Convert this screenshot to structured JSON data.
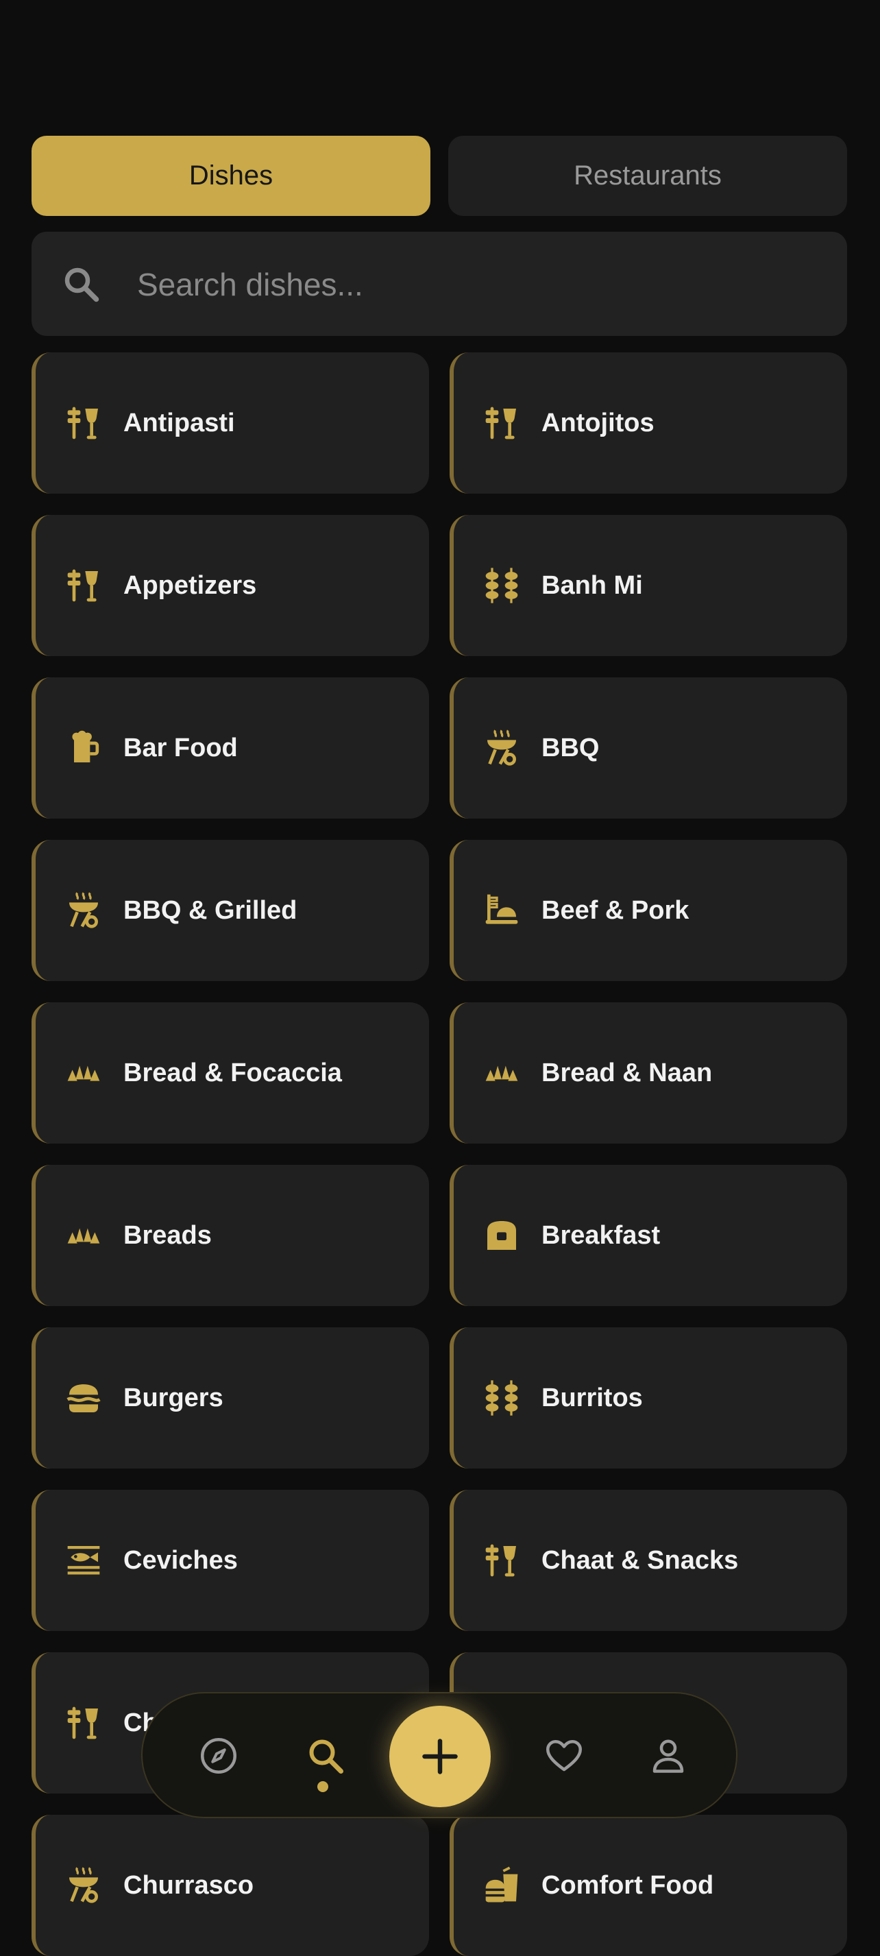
{
  "tabs": {
    "dishes": "Dishes",
    "restaurants": "Restaurants"
  },
  "search": {
    "placeholder": "Search dishes..."
  },
  "categories": [
    {
      "label": "Antipasti",
      "icon": "drinks-icon"
    },
    {
      "label": "Antojitos",
      "icon": "drinks-icon"
    },
    {
      "label": "Appetizers",
      "icon": "drinks-icon"
    },
    {
      "label": "Banh Mi",
      "icon": "kebab-icon"
    },
    {
      "label": "Bar Food",
      "icon": "beer-mug-icon"
    },
    {
      "label": "BBQ",
      "icon": "grill-icon"
    },
    {
      "label": "BBQ & Grilled",
      "icon": "grill-icon"
    },
    {
      "label": "Beef & Pork",
      "icon": "meat-platter-icon"
    },
    {
      "label": "Bread & Focaccia",
      "icon": "croissant-icon"
    },
    {
      "label": "Bread & Naan",
      "icon": "croissant-icon"
    },
    {
      "label": "Breads",
      "icon": "croissant-icon"
    },
    {
      "label": "Breakfast",
      "icon": "toast-icon"
    },
    {
      "label": "Burgers",
      "icon": "burger-icon"
    },
    {
      "label": "Burritos",
      "icon": "kebab-icon"
    },
    {
      "label": "Ceviches",
      "icon": "fish-icon"
    },
    {
      "label": "Chaat & Snacks",
      "icon": "drinks-icon"
    },
    {
      "label": "Ch",
      "icon": "drinks-icon"
    },
    {
      "label": "",
      "icon": ""
    },
    {
      "label": "Churrasco",
      "icon": "grill-icon"
    },
    {
      "label": "Comfort Food",
      "icon": "burger-drink-icon"
    }
  ],
  "nav": {
    "items": [
      {
        "icon": "compass-icon",
        "name": "nav-explore"
      },
      {
        "icon": "search-icon",
        "name": "nav-search",
        "active": true
      },
      {
        "icon": "plus-icon",
        "name": "nav-add"
      },
      {
        "icon": "heart-icon",
        "name": "nav-favorites"
      },
      {
        "icon": "user-icon",
        "name": "nav-profile"
      }
    ]
  },
  "colors": {
    "accent": "#c9a94a",
    "card": "#202020",
    "background": "#0d0d0d"
  }
}
